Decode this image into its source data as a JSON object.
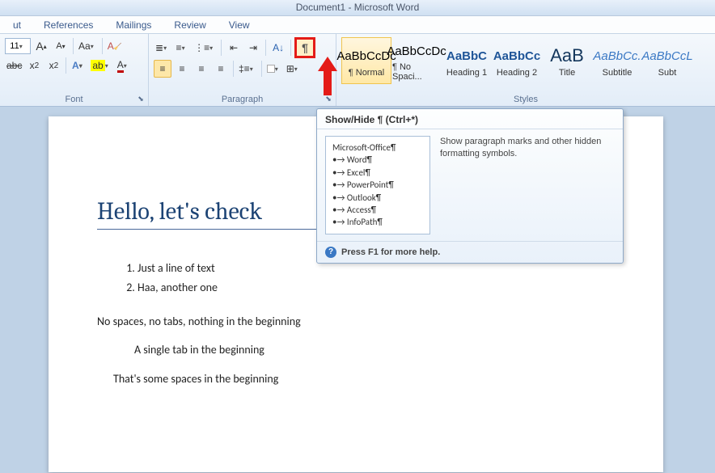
{
  "window": {
    "title": "Document1 - Microsoft Word"
  },
  "tabs": [
    "ut",
    "References",
    "Mailings",
    "Review",
    "View"
  ],
  "font": {
    "size": "11",
    "grow": "A",
    "shrink": "A",
    "case": "Aa",
    "clear": "",
    "strike": "abc",
    "sub": "x",
    "sub2": "₂",
    "sup": "x",
    "sup2": "²",
    "effectsA": "A",
    "highlightA": "",
    "colorA": "A",
    "label": "Font"
  },
  "paragraph": {
    "label": "Paragraph",
    "pilcrow": "¶"
  },
  "styles": {
    "label": "Styles",
    "items": [
      {
        "sample": "AaBbCcDc",
        "name": "¶ Normal",
        "cls": "selected"
      },
      {
        "sample": "AaBbCcDc",
        "name": "¶ No Spaci...",
        "cls": ""
      },
      {
        "sample": "AaBbC",
        "name": "Heading 1",
        "cls": "h1"
      },
      {
        "sample": "AaBbCc",
        "name": "Heading 2",
        "cls": "h2"
      },
      {
        "sample": "AaB",
        "name": "Title",
        "cls": "title"
      },
      {
        "sample": "AaBbCc.",
        "name": "Subtitle",
        "cls": "subtitle"
      },
      {
        "sample": "AaBbCcL",
        "name": "Subt",
        "cls": "subte"
      }
    ]
  },
  "tooltip": {
    "title": "Show/Hide ¶ (Ctrl+*)",
    "desc": "Show paragraph marks and other hidden formatting symbols.",
    "preview_header": "Microsoft·Office¶",
    "preview_items": [
      "Word¶",
      "Excel¶",
      "PowerPoint¶",
      "Outlook¶",
      "Access¶",
      "InfoPath¶"
    ],
    "footer": "Press F1 for more help."
  },
  "document": {
    "title_text": "Hello, let's check",
    "ol": [
      "Just a line of text",
      "Haa, another one"
    ],
    "lines": [
      {
        "text": "No spaces, no tabs, nothing in the beginning",
        "cls": ""
      },
      {
        "text": "A single tab in the beginning",
        "cls": "indent1"
      },
      {
        "text": "That's some spaces in the beginning",
        "cls": "indent2"
      }
    ]
  }
}
